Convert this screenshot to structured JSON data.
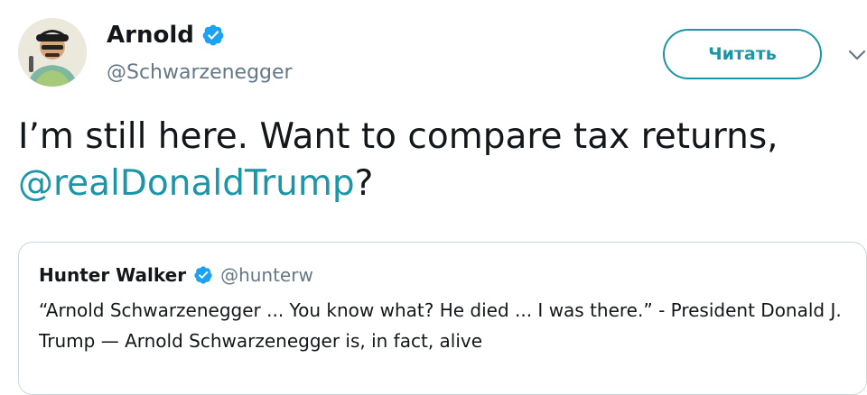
{
  "author": {
    "name": "Arnold",
    "handle": "@Schwarzenegger",
    "verified": true
  },
  "follow_button_label": "Читать",
  "tweet": {
    "text_before": "I’m still here. Want to compare tax returns, ",
    "mention": "@realDonaldTrump",
    "text_after": "?"
  },
  "quoted_tweet": {
    "name": "Hunter Walker",
    "handle": "@hunterw",
    "verified": true,
    "text": "“Arnold Schwarzenegger ... You know what? He died ... I was there.” - President Donald J. Trump — Arnold Schwarzenegger is, in fact, alive"
  },
  "colors": {
    "accent": "#1b95a8",
    "verified_badge": "#1da1f2",
    "secondary_text": "#657786",
    "border": "#ccd6dd"
  },
  "icons": {
    "verified": "verified-badge-icon",
    "caret": "chevron-down-icon"
  }
}
